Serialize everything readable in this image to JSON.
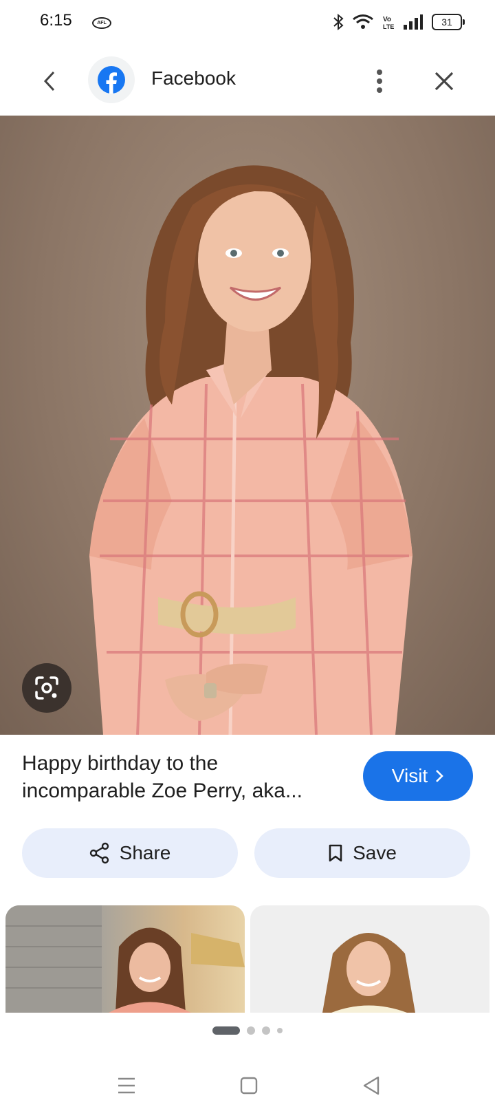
{
  "status_bar": {
    "time": "6:15",
    "afl_badge": "AFL",
    "battery": "31",
    "icons": [
      "bluetooth-icon",
      "wifi-icon",
      "volte-icon",
      "signal-icon",
      "battery-icon"
    ]
  },
  "header": {
    "title": "Facebook",
    "source_icon": "facebook-logo-icon",
    "back_icon": "back-arrow-icon",
    "more_icon": "more-vertical-icon",
    "close_icon": "close-icon"
  },
  "main_image": {
    "lens_icon": "lens-search-icon"
  },
  "caption": {
    "text": "Happy birthday to the incomparable Zoe Perry, aka..."
  },
  "actions": {
    "visit_label": "Visit",
    "share_label": "Share",
    "save_label": "Save"
  },
  "related": {
    "count_visible": 2
  },
  "carousel": {
    "pages": 4,
    "active": 0
  },
  "colors": {
    "accent": "#1a73e8",
    "pill_bg": "#e8eefb",
    "lens_bg": "#3b322d"
  }
}
